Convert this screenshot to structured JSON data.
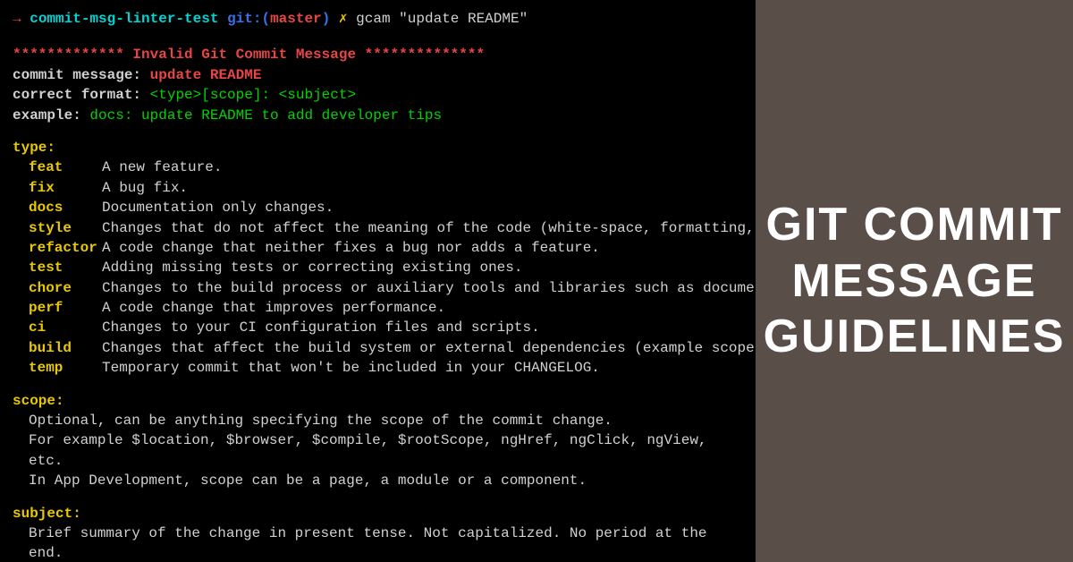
{
  "prompt": {
    "arrow": "→",
    "repo": "commit-msg-linter-test",
    "git_prefix": "git:(",
    "branch": "master",
    "git_suffix": ")",
    "lightning": "✗",
    "command": "gcam \"update README\""
  },
  "error": {
    "banner": "************* Invalid Git Commit Message **************",
    "commit_label": "commit message:",
    "commit_value": "update README",
    "format_label": "correct format:",
    "format_value": "<type>[scope]: <subject>",
    "example_label": "example:",
    "example_value": "docs: update README to add developer tips"
  },
  "type_heading": "type:",
  "types": [
    {
      "key": "feat",
      "desc": "A new feature."
    },
    {
      "key": "fix",
      "desc": "A bug fix."
    },
    {
      "key": "docs",
      "desc": "Documentation only changes."
    },
    {
      "key": "style",
      "desc": "Changes that do not affect the meaning of the code (white-space, formatting,"
    },
    {
      "key": "refactor",
      "desc": "A code change that neither fixes a bug nor adds a feature."
    },
    {
      "key": "test",
      "desc": "Adding missing tests or correcting existing ones."
    },
    {
      "key": "chore",
      "desc": "Changes to the build process or auxiliary tools and libraries such as docume"
    },
    {
      "key": "perf",
      "desc": "A code change that improves performance."
    },
    {
      "key": "ci",
      "desc": "Changes to your CI configuration files and scripts."
    },
    {
      "key": "build",
      "desc": "Changes that affect the build system or external dependencies (example scope"
    },
    {
      "key": "temp",
      "desc": "Temporary commit that won't be included in your CHANGELOG."
    }
  ],
  "scope_heading": "scope:",
  "scope_lines": [
    "Optional, can be anything specifying the scope of the commit change.",
    "For example $location, $browser, $compile, $rootScope, ngHref, ngClick, ngView, etc.",
    "In App Development, scope can be a page, a module or a component."
  ],
  "subject_heading": "subject:",
  "subject_line": "Brief summary of the change in present tense. Not capitalized. No period at the end.",
  "sidebar_title": "GIT COMMIT MESSAGE GUIDELINES"
}
